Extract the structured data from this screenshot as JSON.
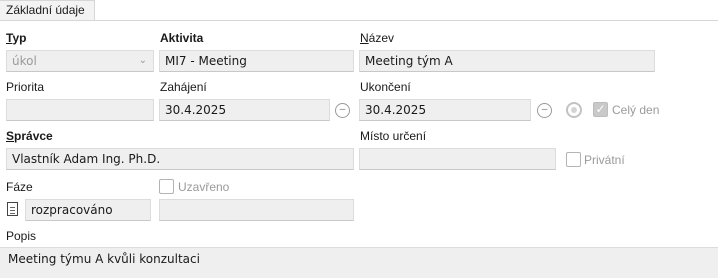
{
  "tab": {
    "label": "Základní údaje"
  },
  "labels": {
    "typ": "Typ",
    "aktivita": "Aktivita",
    "nazev": "Název",
    "priorita": "Priorita",
    "zahajeni": "Zahájení",
    "ukonceni": "Ukončení",
    "spravce": "Správce",
    "misto_urceni": "Místo určení",
    "faze": "Fáze",
    "popis": "Popis"
  },
  "fields": {
    "typ": "úkol",
    "aktivita": "MI7 - Meeting",
    "nazev": "Meeting tým A",
    "priorita": "",
    "zahajeni": "30.4.2025",
    "ukonceni": "30.4.2025",
    "spravce": "Vlastník Adam Ing. Ph.D.",
    "misto_urceni": "",
    "faze": "rozpracováno",
    "faze_extra": "",
    "popis": "Meeting týmu A kvůli konzultaci"
  },
  "checkboxes": {
    "cely_den": {
      "label": "Celý den",
      "checked": true
    },
    "privatni": {
      "label": "Privátní",
      "checked": false
    },
    "uzavreno": {
      "label": "Uzavřeno",
      "checked": false
    }
  },
  "icons": {
    "typ_dropdown": "chevron-down-icon",
    "zahajeni_time": "clock-icon",
    "ukonceni_time": "clock-icon",
    "faze_doc": "document-icon"
  }
}
